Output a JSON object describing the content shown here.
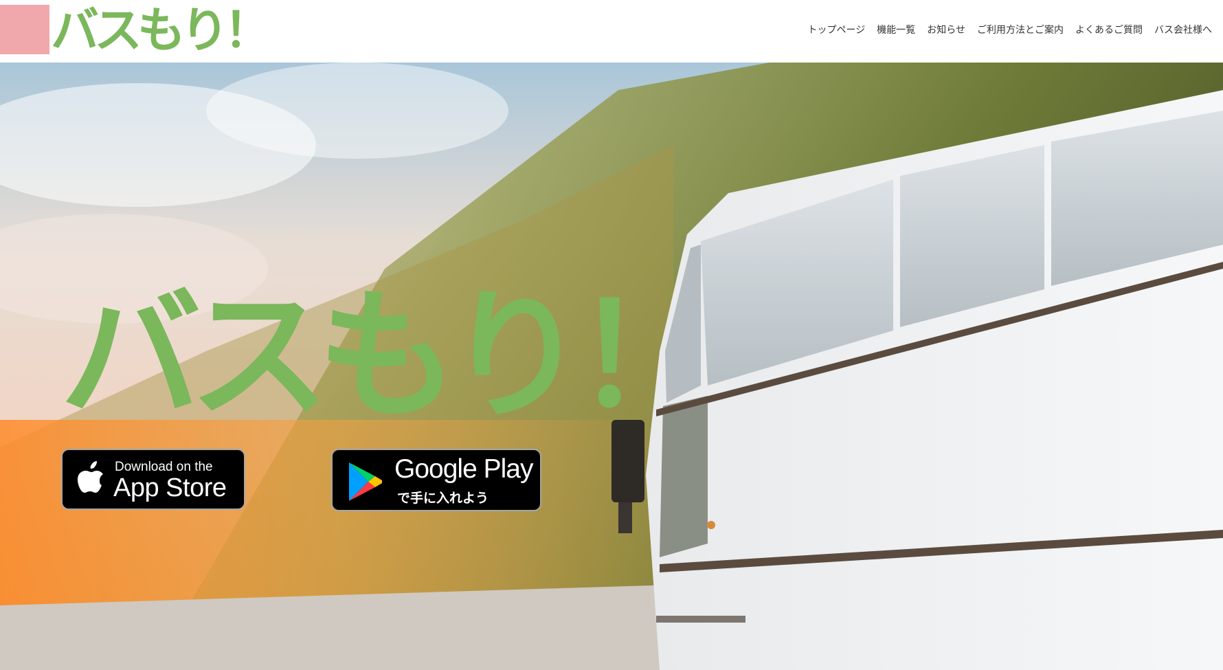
{
  "header": {
    "logo_text": "バスもり！",
    "nav": [
      {
        "label": "トップページ"
      },
      {
        "label": "機能一覧"
      },
      {
        "label": "お知らせ"
      },
      {
        "label": "ご利用方法とご案内"
      },
      {
        "label": "よくあるご質問"
      },
      {
        "label": "バス会社様へ"
      }
    ]
  },
  "hero": {
    "title": "バスもり！",
    "background_image": "motion-blurred white bus on highway with sunset sky",
    "app_store": {
      "icon": "apple-icon",
      "line1": "Download on the",
      "line2": "App Store"
    },
    "google_play": {
      "icon": "google-play-icon",
      "line1": "Google Play",
      "line2": "で手に入れよう"
    }
  },
  "colors": {
    "brand_green": "#7bb75b",
    "logo_pink": "#f0a8ac",
    "nav_text": "#333333",
    "badge_bg": "#000000"
  }
}
